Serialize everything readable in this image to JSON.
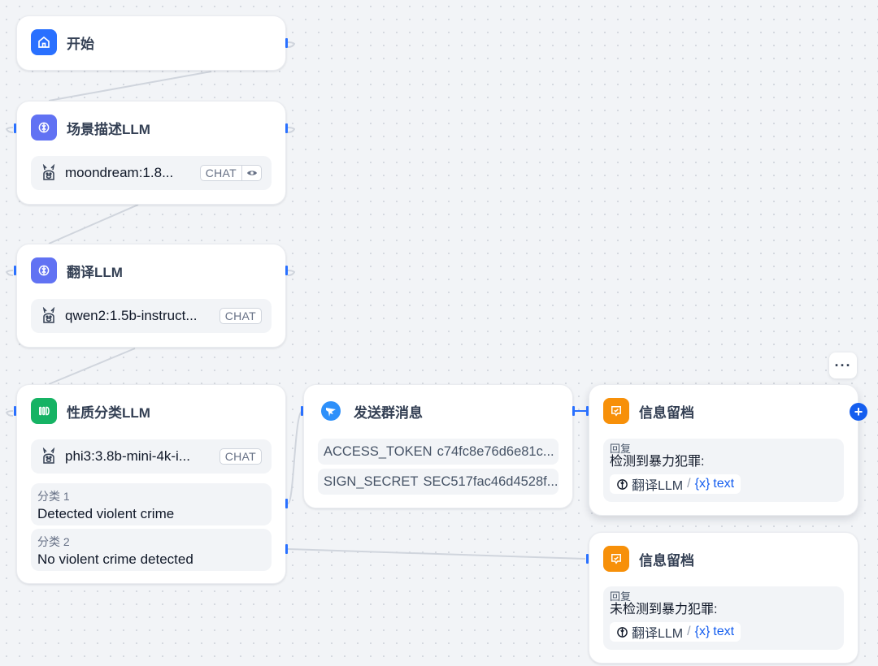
{
  "nodes": {
    "start": {
      "title": "开始",
      "color": "#2970ff",
      "icon": "home-icon"
    },
    "scene_llm": {
      "title": "场景描述LLM",
      "color": "#6172f3",
      "icon": "llm-icon",
      "model": "moondream:1.8...",
      "model_icon": "ollama-icon",
      "badge": "CHAT",
      "vision_icon": "eye-icon"
    },
    "translate_llm": {
      "title": "翻译LLM",
      "color": "#6172f3",
      "icon": "llm-icon",
      "model": "qwen2:1.5b-instruct...",
      "model_icon": "ollama-icon",
      "badge": "CHAT"
    },
    "classify_llm": {
      "title": "性质分类LLM",
      "color": "#16b364",
      "icon": "classifier-icon",
      "model": "phi3:3.8b-mini-4k-i...",
      "model_icon": "ollama-icon",
      "badge": "CHAT",
      "classes": [
        {
          "label": "分类 1",
          "text": "Detected violent crime"
        },
        {
          "label": "分类 2",
          "text": "No violent crime detected"
        }
      ]
    },
    "send_group": {
      "title": "发送群消息",
      "color": "#2e90fa",
      "icon": "dingtalk-icon",
      "params": [
        {
          "key": "ACCESS_TOKEN",
          "value": "c74fc8e76d6e81c..."
        },
        {
          "key": "SIGN_SECRET",
          "value": "SEC517fac46d4528f..."
        }
      ]
    },
    "archive_1": {
      "title": "信息留档",
      "color": "#f79009",
      "icon": "answer-icon",
      "reply_label": "回复",
      "reply_text": "检测到暴力犯罪:",
      "var_node": "翻译LLM",
      "var_sep": "/",
      "var_symbol": "{x}",
      "var_name": "text"
    },
    "archive_2": {
      "title": "信息留档",
      "color": "#f79009",
      "icon": "answer-icon",
      "reply_label": "回复",
      "reply_text": "未检测到暴力犯罪:",
      "var_node": "翻译LLM",
      "var_sep": "/",
      "var_symbol": "{x}",
      "var_name": "text"
    }
  },
  "controls": {
    "more_label": "···",
    "add_label": "+"
  },
  "colors": {
    "edge": "#d0d5dd",
    "handle": "#2970ff",
    "accent": "#155eef"
  }
}
